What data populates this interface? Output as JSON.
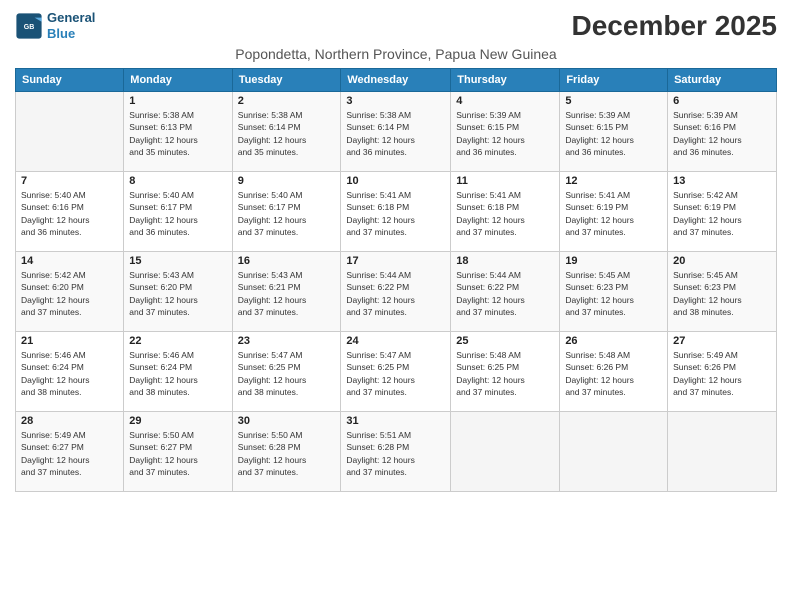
{
  "logo": {
    "line1": "General",
    "line2": "Blue"
  },
  "title": "December 2025",
  "subtitle": "Popondetta, Northern Province, Papua New Guinea",
  "weekdays": [
    "Sunday",
    "Monday",
    "Tuesday",
    "Wednesday",
    "Thursday",
    "Friday",
    "Saturday"
  ],
  "weeks": [
    [
      {
        "day": "",
        "info": ""
      },
      {
        "day": "1",
        "info": "Sunrise: 5:38 AM\nSunset: 6:13 PM\nDaylight: 12 hours\nand 35 minutes."
      },
      {
        "day": "2",
        "info": "Sunrise: 5:38 AM\nSunset: 6:14 PM\nDaylight: 12 hours\nand 35 minutes."
      },
      {
        "day": "3",
        "info": "Sunrise: 5:38 AM\nSunset: 6:14 PM\nDaylight: 12 hours\nand 36 minutes."
      },
      {
        "day": "4",
        "info": "Sunrise: 5:39 AM\nSunset: 6:15 PM\nDaylight: 12 hours\nand 36 minutes."
      },
      {
        "day": "5",
        "info": "Sunrise: 5:39 AM\nSunset: 6:15 PM\nDaylight: 12 hours\nand 36 minutes."
      },
      {
        "day": "6",
        "info": "Sunrise: 5:39 AM\nSunset: 6:16 PM\nDaylight: 12 hours\nand 36 minutes."
      }
    ],
    [
      {
        "day": "7",
        "info": "Sunrise: 5:40 AM\nSunset: 6:16 PM\nDaylight: 12 hours\nand 36 minutes."
      },
      {
        "day": "8",
        "info": "Sunrise: 5:40 AM\nSunset: 6:17 PM\nDaylight: 12 hours\nand 36 minutes."
      },
      {
        "day": "9",
        "info": "Sunrise: 5:40 AM\nSunset: 6:17 PM\nDaylight: 12 hours\nand 37 minutes."
      },
      {
        "day": "10",
        "info": "Sunrise: 5:41 AM\nSunset: 6:18 PM\nDaylight: 12 hours\nand 37 minutes."
      },
      {
        "day": "11",
        "info": "Sunrise: 5:41 AM\nSunset: 6:18 PM\nDaylight: 12 hours\nand 37 minutes."
      },
      {
        "day": "12",
        "info": "Sunrise: 5:41 AM\nSunset: 6:19 PM\nDaylight: 12 hours\nand 37 minutes."
      },
      {
        "day": "13",
        "info": "Sunrise: 5:42 AM\nSunset: 6:19 PM\nDaylight: 12 hours\nand 37 minutes."
      }
    ],
    [
      {
        "day": "14",
        "info": "Sunrise: 5:42 AM\nSunset: 6:20 PM\nDaylight: 12 hours\nand 37 minutes."
      },
      {
        "day": "15",
        "info": "Sunrise: 5:43 AM\nSunset: 6:20 PM\nDaylight: 12 hours\nand 37 minutes."
      },
      {
        "day": "16",
        "info": "Sunrise: 5:43 AM\nSunset: 6:21 PM\nDaylight: 12 hours\nand 37 minutes."
      },
      {
        "day": "17",
        "info": "Sunrise: 5:44 AM\nSunset: 6:22 PM\nDaylight: 12 hours\nand 37 minutes."
      },
      {
        "day": "18",
        "info": "Sunrise: 5:44 AM\nSunset: 6:22 PM\nDaylight: 12 hours\nand 37 minutes."
      },
      {
        "day": "19",
        "info": "Sunrise: 5:45 AM\nSunset: 6:23 PM\nDaylight: 12 hours\nand 37 minutes."
      },
      {
        "day": "20",
        "info": "Sunrise: 5:45 AM\nSunset: 6:23 PM\nDaylight: 12 hours\nand 38 minutes."
      }
    ],
    [
      {
        "day": "21",
        "info": "Sunrise: 5:46 AM\nSunset: 6:24 PM\nDaylight: 12 hours\nand 38 minutes."
      },
      {
        "day": "22",
        "info": "Sunrise: 5:46 AM\nSunset: 6:24 PM\nDaylight: 12 hours\nand 38 minutes."
      },
      {
        "day": "23",
        "info": "Sunrise: 5:47 AM\nSunset: 6:25 PM\nDaylight: 12 hours\nand 38 minutes."
      },
      {
        "day": "24",
        "info": "Sunrise: 5:47 AM\nSunset: 6:25 PM\nDaylight: 12 hours\nand 37 minutes."
      },
      {
        "day": "25",
        "info": "Sunrise: 5:48 AM\nSunset: 6:25 PM\nDaylight: 12 hours\nand 37 minutes."
      },
      {
        "day": "26",
        "info": "Sunrise: 5:48 AM\nSunset: 6:26 PM\nDaylight: 12 hours\nand 37 minutes."
      },
      {
        "day": "27",
        "info": "Sunrise: 5:49 AM\nSunset: 6:26 PM\nDaylight: 12 hours\nand 37 minutes."
      }
    ],
    [
      {
        "day": "28",
        "info": "Sunrise: 5:49 AM\nSunset: 6:27 PM\nDaylight: 12 hours\nand 37 minutes."
      },
      {
        "day": "29",
        "info": "Sunrise: 5:50 AM\nSunset: 6:27 PM\nDaylight: 12 hours\nand 37 minutes."
      },
      {
        "day": "30",
        "info": "Sunrise: 5:50 AM\nSunset: 6:28 PM\nDaylight: 12 hours\nand 37 minutes."
      },
      {
        "day": "31",
        "info": "Sunrise: 5:51 AM\nSunset: 6:28 PM\nDaylight: 12 hours\nand 37 minutes."
      },
      {
        "day": "",
        "info": ""
      },
      {
        "day": "",
        "info": ""
      },
      {
        "day": "",
        "info": ""
      }
    ]
  ]
}
